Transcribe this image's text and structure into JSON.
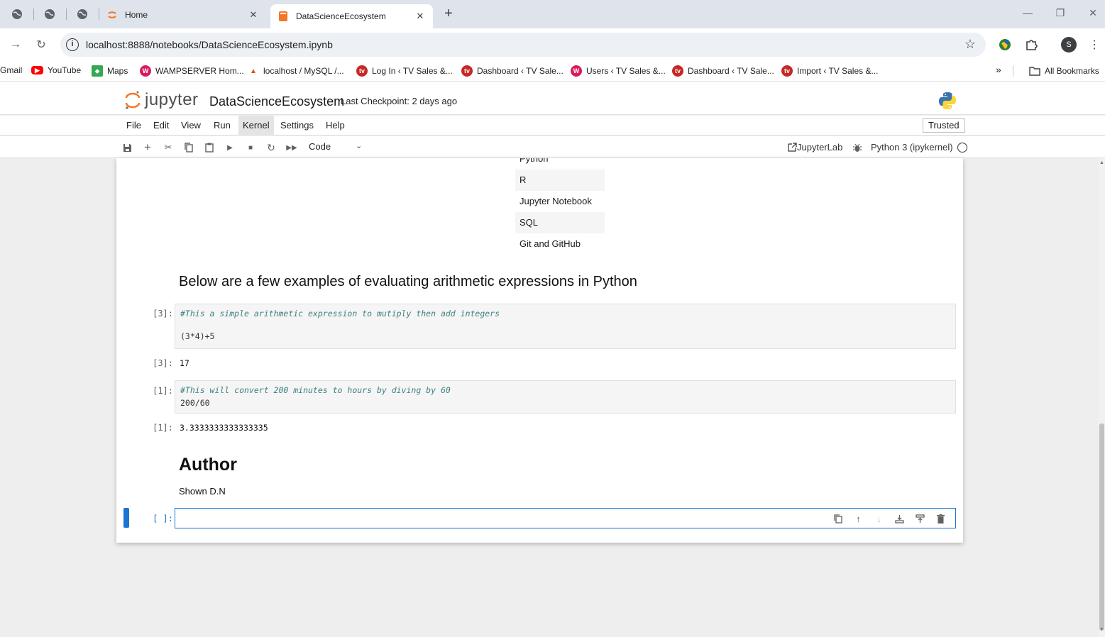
{
  "browser": {
    "tabs": [
      {
        "title": "Home"
      },
      {
        "title": "DataScienceEcosystem"
      }
    ],
    "url": "localhost:8888/notebooks/DataScienceEcosystem.ipynb",
    "avatar_letter": "S",
    "bookmarks": [
      {
        "label": "Gmail"
      },
      {
        "label": "YouTube"
      },
      {
        "label": "Maps"
      },
      {
        "label": "WAMPSERVER Hom..."
      },
      {
        "label": "localhost / MySQL /..."
      },
      {
        "label": "Log In ‹ TV Sales &..."
      },
      {
        "label": "Dashboard ‹ TV Sale..."
      },
      {
        "label": "Users ‹ TV Sales &..."
      },
      {
        "label": "Dashboard ‹ TV Sale..."
      },
      {
        "label": "Import ‹ TV Sales &..."
      }
    ],
    "all_bookmarks": "All Bookmarks"
  },
  "jupyter": {
    "logo_text": "jupyter",
    "notebook_title": "DataScienceEcosystem",
    "checkpoint": "Last Checkpoint: 2 days ago",
    "menu": [
      "File",
      "Edit",
      "View",
      "Run",
      "Kernel",
      "Settings",
      "Help"
    ],
    "active_menu": "Kernel",
    "trusted": "Trusted",
    "cell_type": "Code",
    "jupyterlab_link": "JupyterLab",
    "kernel": "Python 3 (ipykernel)"
  },
  "notebook": {
    "languages": [
      "Python",
      "R",
      "Jupyter Notebook",
      "SQL",
      "Git and GitHub"
    ],
    "heading_examples": "Below are a few examples of evaluating arithmetic expressions in Python",
    "cell1": {
      "in_prompt": "[3]:",
      "comment": "#This a simple arithmetic expression to mutiply then add integers",
      "code": "(3*4)+5",
      "out_prompt": "[3]:",
      "output": "17"
    },
    "cell2": {
      "in_prompt": "[1]:",
      "comment": "#This will convert 200 minutes to hours by diving by 60",
      "code": "200/60",
      "out_prompt": "[1]:",
      "output": "3.3333333333333335"
    },
    "author_heading": "Author",
    "author_name": "Shown D.N",
    "empty_prompt": "[ ]:"
  }
}
